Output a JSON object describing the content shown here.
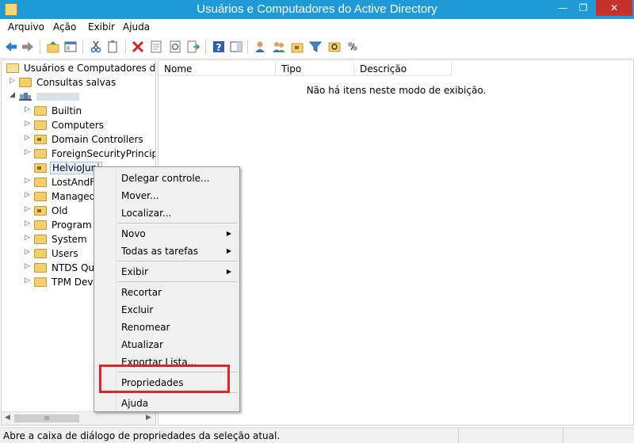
{
  "window": {
    "title": "Usuários e Computadores do Active Directory",
    "min_glyph": "—",
    "max_glyph": "❐",
    "close_glyph": "✕"
  },
  "menubar": {
    "items": [
      "Arquivo",
      "Ação",
      "Exibir",
      "Ajuda"
    ]
  },
  "toolbar": {
    "icons": [
      "back-arrow-icon",
      "forward-arrow-icon",
      "up-folder-icon",
      "show-hide-tree-icon",
      "cut-icon",
      "copy-icon",
      "delete-icon",
      "properties-icon",
      "refresh-icon",
      "export-list-icon",
      "help-icon",
      "action-pane-icon",
      "new-user-icon",
      "new-group-icon",
      "new-ou-icon",
      "filter-icon",
      "find-icon",
      "delegate-icon"
    ]
  },
  "tree": {
    "root_label": "Usuários e Computadores do Ac",
    "items": [
      {
        "label": "Consultas salvas",
        "level": 1,
        "expander": "▷",
        "ou": false
      },
      {
        "label": "",
        "level": 1,
        "expander": "◢",
        "ou": false,
        "domain": true
      },
      {
        "label": "Builtin",
        "level": 2,
        "expander": "▷",
        "ou": false
      },
      {
        "label": "Computers",
        "level": 2,
        "expander": "▷",
        "ou": false
      },
      {
        "label": "Domain Controllers",
        "level": 2,
        "expander": "▷",
        "ou": true
      },
      {
        "label": "ForeignSecurityPrincipals",
        "level": 2,
        "expander": "▷",
        "ou": false
      },
      {
        "label": "HelvioJuni",
        "level": 2,
        "expander": "",
        "ou": true,
        "selected": true
      },
      {
        "label": "LostAndFo",
        "level": 2,
        "expander": "▷",
        "ou": false
      },
      {
        "label": "Managed",
        "level": 2,
        "expander": "▷",
        "ou": false
      },
      {
        "label": "Old",
        "level": 2,
        "expander": "▷",
        "ou": true
      },
      {
        "label": "Program D",
        "level": 2,
        "expander": "▷",
        "ou": false
      },
      {
        "label": "System",
        "level": 2,
        "expander": "▷",
        "ou": false
      },
      {
        "label": "Users",
        "level": 2,
        "expander": "▷",
        "ou": false
      },
      {
        "label": "NTDS Quo",
        "level": 2,
        "expander": "▷",
        "ou": false
      },
      {
        "label": "TPM Devic",
        "level": 2,
        "expander": "▷",
        "ou": false
      }
    ],
    "scroll_left": "◀",
    "scroll_right": "▶",
    "scroll_grip": "III"
  },
  "list": {
    "columns": [
      "Nome",
      "Tipo",
      "Descrição"
    ],
    "empty_message": "Não há itens neste modo de exibição."
  },
  "context_menu": {
    "items": [
      {
        "label": "Delegar controle...",
        "submenu": false
      },
      {
        "label": "Mover...",
        "submenu": false
      },
      {
        "label": "Localizar...",
        "submenu": false
      },
      {
        "separator": true
      },
      {
        "label": "Novo",
        "submenu": true
      },
      {
        "label": "Todas as tarefas",
        "submenu": true
      },
      {
        "separator": true
      },
      {
        "label": "Exibir",
        "submenu": true
      },
      {
        "separator": true
      },
      {
        "label": "Recortar",
        "submenu": false
      },
      {
        "label": "Excluir",
        "submenu": false
      },
      {
        "label": "Renomear",
        "submenu": false
      },
      {
        "label": "Atualizar",
        "submenu": false
      },
      {
        "label": "Exportar Lista...",
        "submenu": false
      },
      {
        "separator": true
      },
      {
        "label": "Propriedades",
        "submenu": false,
        "highlighted": true
      },
      {
        "separator": true
      },
      {
        "label": "Ajuda",
        "submenu": false
      }
    ],
    "submenu_glyph": "▶",
    "highlight_color": "#d9262b"
  },
  "statusbar": {
    "text": "Abre a caixa de diálogo de propriedades da seleção atual."
  },
  "colors": {
    "titlebar": "#1e9ad7",
    "close": "#c7312b",
    "folder": "#f2cf6b"
  }
}
